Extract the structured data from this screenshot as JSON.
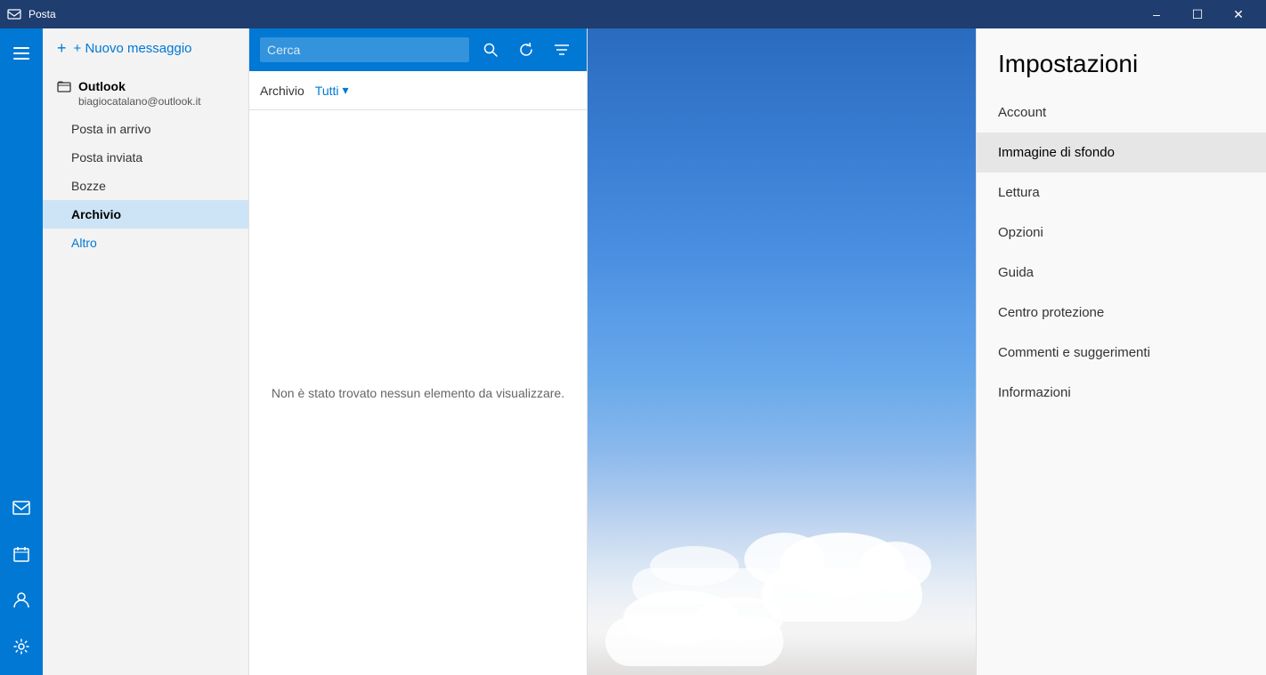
{
  "titlebar": {
    "title": "Posta",
    "minimize_label": "–",
    "maximize_label": "☐",
    "close_label": "✕"
  },
  "nav": {
    "hamburger_icon": "☰",
    "bottom_icons": [
      {
        "name": "mail-icon",
        "symbol": "✉"
      },
      {
        "name": "calendar-icon",
        "symbol": "📅"
      },
      {
        "name": "people-icon",
        "symbol": "☺"
      },
      {
        "name": "settings-icon",
        "symbol": "⚙"
      }
    ]
  },
  "folder_panel": {
    "new_message_label": "+ Nuovo messaggio",
    "account_name": "Outlook",
    "account_email": "biagiocatalano@outlook.it",
    "folders": [
      {
        "label": "Posta in arrivo",
        "active": false
      },
      {
        "label": "Posta inviata",
        "active": false
      },
      {
        "label": "Bozze",
        "active": false
      },
      {
        "label": "Archivio",
        "active": true
      },
      {
        "label": "Altro",
        "active": false,
        "link": true
      }
    ]
  },
  "message_panel": {
    "search_placeholder": "Cerca",
    "filter_label": "Archivio",
    "filter_dropdown": "Tutti",
    "empty_message": "Non è stato trovato nessun elemento da visualizzare."
  },
  "settings_panel": {
    "title": "Impostazioni",
    "items": [
      {
        "label": "Account",
        "active": false
      },
      {
        "label": "Immagine di sfondo",
        "active": true
      },
      {
        "label": "Lettura",
        "active": false
      },
      {
        "label": "Opzioni",
        "active": false
      },
      {
        "label": "Guida",
        "active": false
      },
      {
        "label": "Centro protezione",
        "active": false
      },
      {
        "label": "Commenti e suggerimenti",
        "active": false
      },
      {
        "label": "Informazioni",
        "active": false
      }
    ]
  },
  "colors": {
    "accent": "#0078d4",
    "titlebar_bg": "#1f3d6e",
    "sidebar_bg": "#0078d4",
    "folder_active_bg": "#cde4f7",
    "settings_active_bg": "#e6e6e6"
  }
}
